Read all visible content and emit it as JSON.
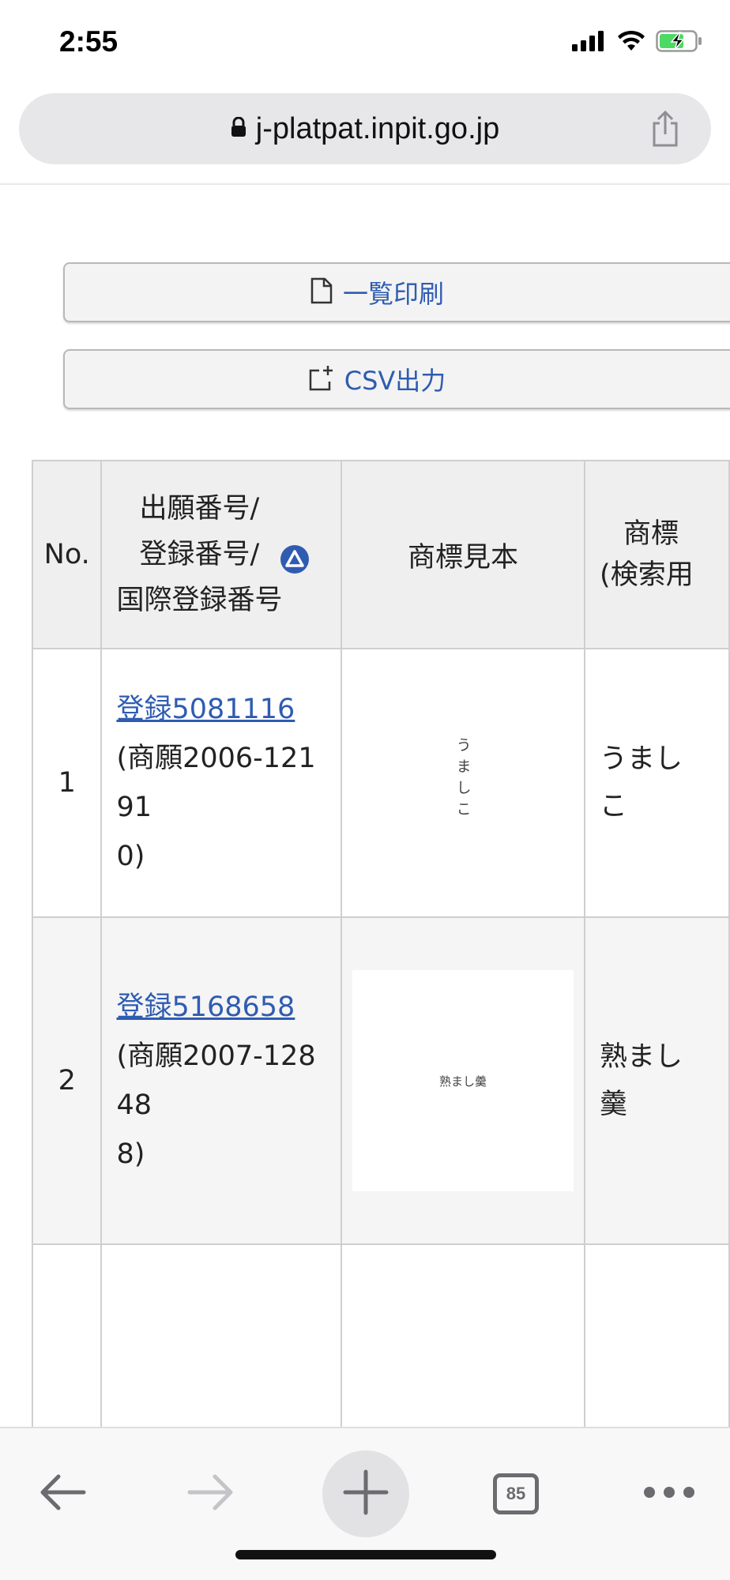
{
  "status_bar": {
    "time": "2:55",
    "icons": [
      "cellular-signal-icon",
      "wifi-icon",
      "battery-charging-icon"
    ]
  },
  "browser": {
    "url": "j-platpat.inpit.go.jp",
    "lock_icon": "lock-icon",
    "share_icon": "share-icon"
  },
  "actions": {
    "print_label": "一覧印刷",
    "print_icon": "document-icon",
    "csv_label": "CSV出力",
    "csv_icon": "export-icon"
  },
  "table": {
    "headers": {
      "no": "No.",
      "number_line1": "出願番号/",
      "number_line2": "登録番号/",
      "number_line3": "国際登録番号",
      "sample": "商標見本",
      "name_line1": "商標",
      "name_line2": "(検索用"
    },
    "sort_icon": "sort-ascending-icon",
    "rows": [
      {
        "no": "1",
        "reg_link": "登録5081116",
        "app_line1": "(商願2006-12191",
        "app_line2": "0)",
        "mark_text": "うましこ",
        "name_line1": "うまし",
        "name_line2": "こ"
      },
      {
        "no": "2",
        "reg_link": "登録5168658",
        "app_line1": "(商願2007-12848",
        "app_line2": "8)",
        "mark_text": "熟まし羹",
        "name_line1": "熟まし",
        "name_line2": "羹"
      }
    ]
  },
  "toolbar": {
    "tab_count": "85",
    "accent": "#2f5cb1"
  }
}
